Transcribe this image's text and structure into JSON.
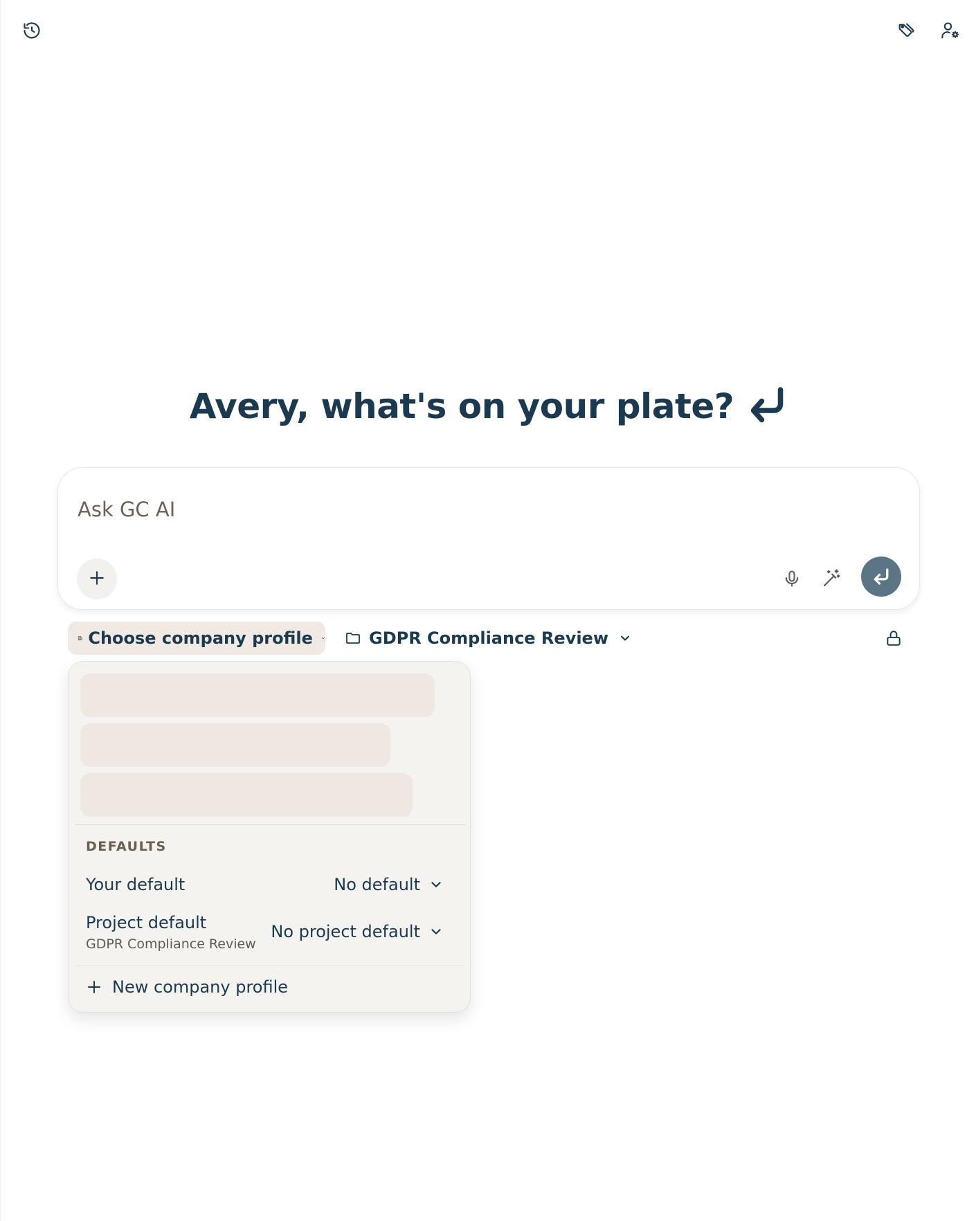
{
  "header": {
    "history_icon": "history-icon",
    "tags_icon": "tags-icon",
    "user_settings_icon": "user-settings-icon"
  },
  "greeting": {
    "text": "Avery, what's on your plate?",
    "icon": "return-arrow-icon"
  },
  "composer": {
    "placeholder": "Ask GC AI",
    "value": "",
    "add_icon": "plus-icon",
    "mic_icon": "microphone-icon",
    "wand_icon": "magic-wand-icon",
    "send_icon": "send-return-icon"
  },
  "chips": {
    "profile_label": "Choose company profile",
    "project_label": "GDPR Compliance Review",
    "lock_icon": "lock-icon"
  },
  "dropdown": {
    "loading_rows": 3,
    "defaults_heading": "DEFAULTS",
    "your_default_label": "Your default",
    "your_default_value": "No default",
    "project_default_label": "Project default",
    "project_default_sub": "GDPR Compliance Review",
    "project_default_value": "No project default",
    "new_profile_label": "New company profile"
  },
  "colors": {
    "text_primary": "#1c3a4f",
    "chip_bg": "#f1e9e3",
    "send_button": "#5b7584",
    "dropdown_bg": "#f4f3f0",
    "skeleton": "#efe7e1"
  }
}
